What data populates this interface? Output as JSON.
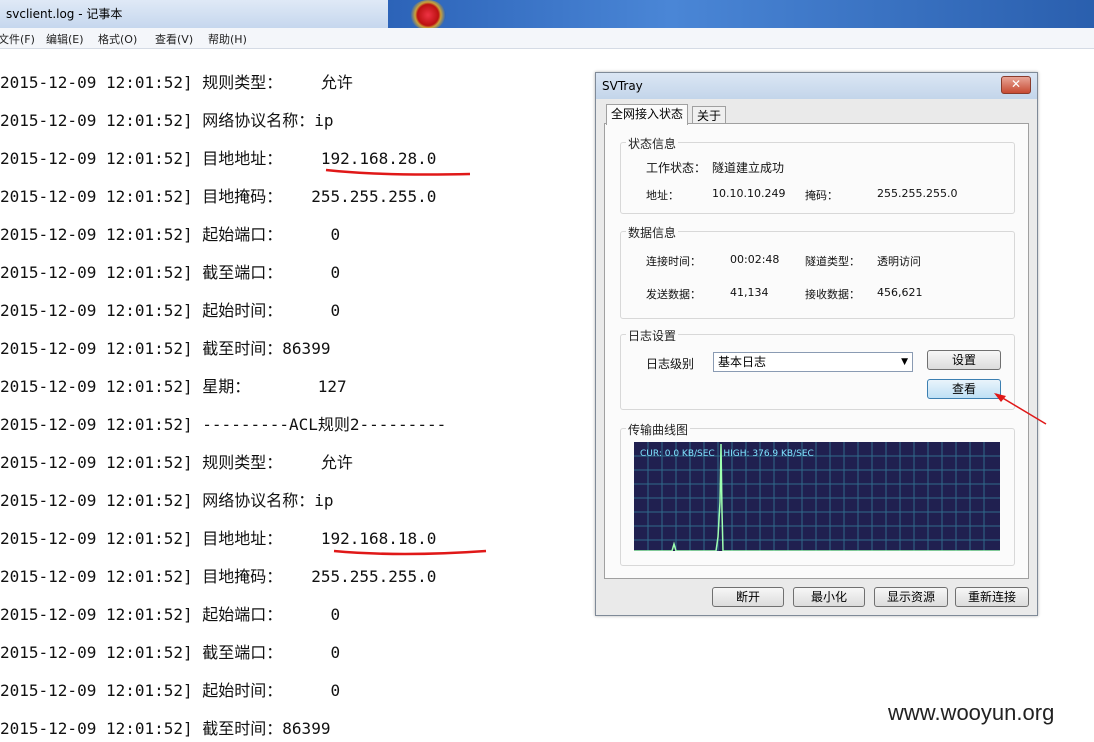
{
  "notepad": {
    "title": "svclient.log - 记事本",
    "menu": [
      "文件(F)",
      "编辑(E)",
      "格式(O)",
      "查看(V)",
      "帮助(H)"
    ],
    "lines": [
      "2015-12-09 12:01:52] 规则类型：    允许",
      "2015-12-09 12:01:52] 网络协议名称：ip",
      "2015-12-09 12:01:52] 目地地址：    192.168.28.0",
      "2015-12-09 12:01:52] 目地掩码：   255.255.255.0",
      "2015-12-09 12:01:52] 起始端口：     0",
      "2015-12-09 12:01:52] 截至端口：     0",
      "2015-12-09 12:01:52] 起始时间：     0",
      "2015-12-09 12:01:52] 截至时间：86399",
      "2015-12-09 12:01:52] 星期：       127",
      "2015-12-09 12:01:52] ---------ACL规则2---------",
      "2015-12-09 12:01:52] 规则类型：    允许",
      "2015-12-09 12:01:52] 网络协议名称：ip",
      "2015-12-09 12:01:52] 目地地址：    192.168.18.0",
      "2015-12-09 12:01:52] 目地掩码：   255.255.255.0",
      "2015-12-09 12:01:52] 起始端口：     0",
      "2015-12-09 12:01:52] 截至端口：     0",
      "2015-12-09 12:01:52] 起始时间：     0",
      "2015-12-09 12:01:52] 截至时间：86399"
    ]
  },
  "svtray": {
    "title": "SVTray",
    "close_label": "✕",
    "tabs": [
      "全网接入状态",
      "关于"
    ],
    "status": {
      "group_label": "状态信息",
      "work_state_label": "工作状态：",
      "work_state_value": "隧道建立成功",
      "address_label": "地址：",
      "address_value": "10.10.10.249",
      "mask_label": "掩码：",
      "mask_value": "255.255.255.0"
    },
    "data": {
      "group_label": "数据信息",
      "conn_time_label": "连接时间：",
      "conn_time_value": "00:02:48",
      "tunnel_type_label": "隧道类型：",
      "tunnel_type_value": "透明访问",
      "sent_label": "发送数据：",
      "sent_value": "41,134",
      "recv_label": "接收数据：",
      "recv_value": "456,621"
    },
    "log": {
      "group_label": "日志设置",
      "level_label": "日志级别",
      "level_value": "基本日志",
      "settings_button": "设置",
      "view_button": "查看"
    },
    "graph": {
      "group_label": "传输曲线图",
      "cur_text": "CUR: 0.0 KB/SEC",
      "high_text": "HIGH: 376.9 KB/SEC",
      "grid_color": "#2f6a8a",
      "line_color": "#9fffb0"
    },
    "buttons": [
      "断开",
      "最小化",
      "显示资源",
      "重新连接"
    ]
  },
  "watermark": "www.wooyun.org"
}
